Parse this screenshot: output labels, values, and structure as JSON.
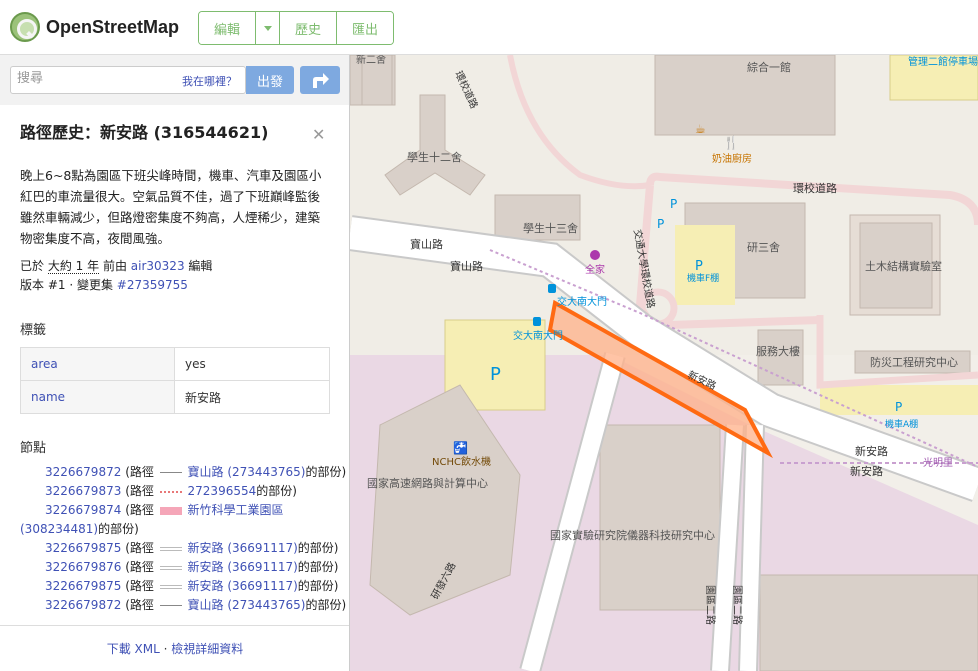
{
  "header": {
    "brand": "OpenStreetMap",
    "edit_label": "編輯",
    "history_label": "歷史",
    "export_label": "匯出"
  },
  "search": {
    "placeholder": "搜尋",
    "where_am_i": "我在哪裡？",
    "go_label": "出發"
  },
  "way": {
    "title": "路徑歷史：新安路 (316544621)",
    "description": "晚上6~8點為園區下班尖峰時間，機車、汽車及園區小紅巴的車流量很大。空氣品質不佳，過了下班巔峰監後雖然車輛減少，但路燈密集度不夠高，人煙稀少，建築物密集度不高，夜間風強。",
    "edited_prefix": "已於",
    "edited_time": "大約 1 年",
    "edited_mid": "前由",
    "editor": "air30323",
    "edited_suffix": "編輯",
    "version_text": "版本 #1 · 變更集",
    "changeset": "#27359755"
  },
  "tags": {
    "heading": "標籤",
    "rows": [
      {
        "key": "area",
        "value": "yes"
      },
      {
        "key": "name",
        "value": "新安路"
      }
    ]
  },
  "nodes": {
    "heading": "節點",
    "rows": [
      {
        "id": "3226679872",
        "pre": "(路徑",
        "way": "寶山路 (273443765)",
        "post": "的部份)"
      },
      {
        "id": "3226679873",
        "pre": "(路徑",
        "way": "272396554",
        "post": "的部份)"
      },
      {
        "id": "3226679874",
        "pre": "(路徑",
        "way": "新竹科學工業園區 (308234481)",
        "post": "的部份)"
      },
      {
        "id": "3226679875",
        "pre": "(路徑",
        "way": "新安路 (36691117)",
        "post": "的部份)"
      },
      {
        "id": "3226679876",
        "pre": "(路徑",
        "way": "新安路 (36691117)",
        "post": "的部份)"
      },
      {
        "id": "3226679875",
        "pre": "(路徑",
        "way": "新安路 (36691117)",
        "post": "的部份)"
      },
      {
        "id": "3226679872",
        "pre": "(路徑",
        "way": "寶山路 (273443765)",
        "post": "的部份)"
      }
    ]
  },
  "footer": {
    "download": "下載 XML",
    "separator": "·",
    "details": "檢視詳細資料"
  },
  "map": {
    "labels": {
      "admin_building": "綜合一館",
      "mgmt_building": "管理二館停車場",
      "dorm12": "學生十二舍",
      "dorm13": "學生十三舍",
      "dorm_partial": "研三舍",
      "civil_lab": "土木結構實驗室",
      "disaster_center": "防災工程研究中心",
      "service_building": "服務大樓",
      "milk_restaurant": "奶油廚房",
      "ring_road": "環校道路",
      "ring_road2": "環校道路",
      "baoshan_road": "寶山路",
      "baoshan_road2": "寶山路",
      "xinan_road": "新安路",
      "xinan_road2": "新安路",
      "xinan_road3": "新安路",
      "quanjia": "全家",
      "south_gate": "交大南大門",
      "south_gate2": "交大南大門",
      "moto_f": "機車F棚",
      "moto_a": "機車A棚",
      "ncku_ring": "交通大學環校道路",
      "nchc_water": "NCHC飲水機",
      "nchc_center": "國家高速網路與計算中心",
      "itrc": "國家實驗研究院儀器科技研究中心",
      "yanfa6": "研發六路",
      "yuanqu2a": "園區二路",
      "yuanqu2b": "園區二路",
      "guangming": "光明里",
      "xin2": "新二舍"
    },
    "highlight_color": "#ff6a13"
  }
}
